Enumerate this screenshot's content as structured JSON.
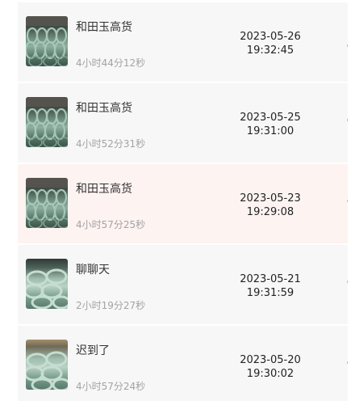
{
  "records": [
    {
      "title": "和田玉高货",
      "duration": "4小时44分12秒",
      "date": "2023-05-26",
      "time": "19:32:45",
      "thumb": "green-jade-bangles-display",
      "highlighted": false
    },
    {
      "title": "和田玉高货",
      "duration": "4小时52分31秒",
      "date": "2023-05-25",
      "time": "19:31:00",
      "thumb": "green-jade-bangles-display",
      "highlighted": false
    },
    {
      "title": "和田玉高货",
      "duration": "4小时57分25秒",
      "date": "2023-05-23",
      "time": "19:29:08",
      "thumb": "green-jade-bangles-display",
      "highlighted": true
    },
    {
      "title": "聊聊天",
      "duration": "2小时19分27秒",
      "date": "2023-05-21",
      "time": "19:31:59",
      "thumb": "green-jade-bangles-pile",
      "highlighted": false
    },
    {
      "title": "迟到了",
      "duration": "4小时57分24秒",
      "date": "2023-05-20",
      "time": "19:30:02",
      "thumb": "green-jade-bangles-pile",
      "highlighted": false
    }
  ],
  "colors": {
    "row_bg": "#f7f7f7",
    "row_highlight_bg": "#fdf3f1",
    "title_text": "#333333",
    "duration_text": "#a3a3a3",
    "datetime_text": "#222222"
  }
}
